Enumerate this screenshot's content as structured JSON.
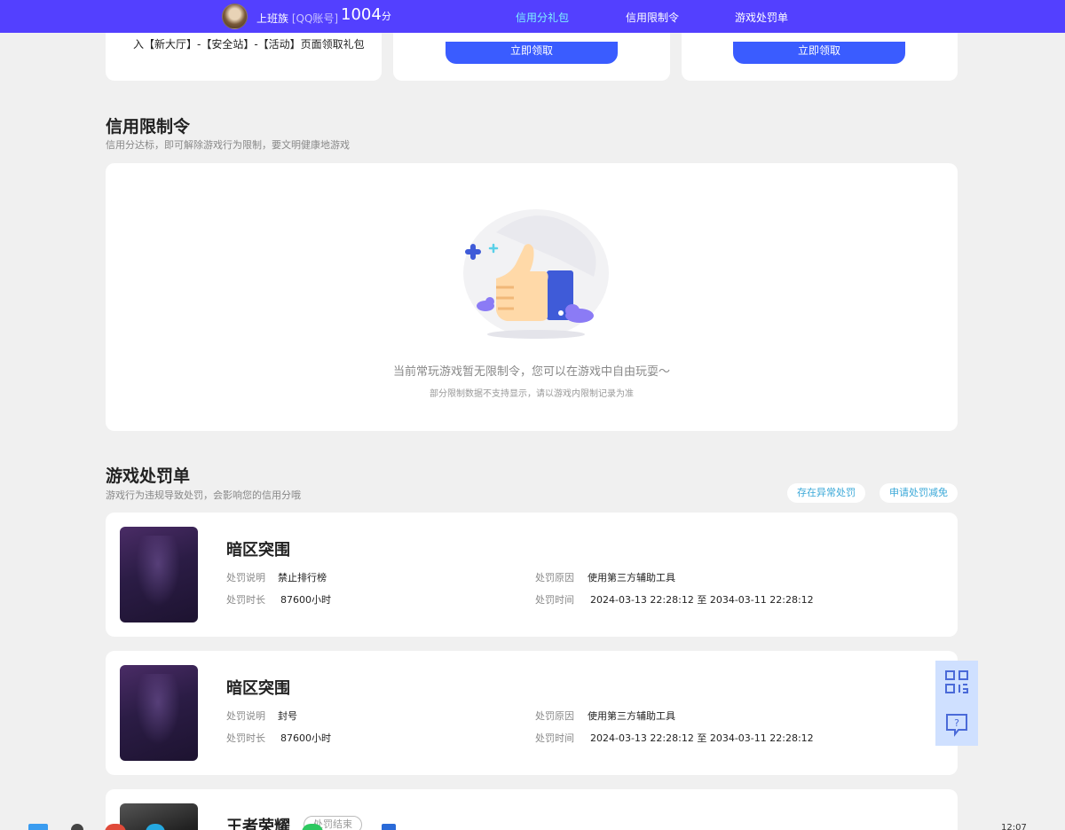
{
  "topbar": {
    "user_name": "上班族",
    "account_tag": "[QQ账号]",
    "score_value": "1004",
    "score_unit": "分",
    "nav": [
      {
        "label": "信用分礼包",
        "active": true
      },
      {
        "label": "信用限制令",
        "active": false
      },
      {
        "label": "游戏处罚单",
        "active": false
      }
    ]
  },
  "gift_cards": {
    "first_text": "入【新大厅】-【安全站】-【活动】页面领取礼包",
    "claim_label": "立即领取"
  },
  "restriction": {
    "title": "信用限制令",
    "subtitle": "信用分达标，即可解除游戏行为限制，要文明健康地游戏",
    "empty_message": "当前常玩游戏暂无限制令，您可以在游戏中自由玩耍～",
    "empty_note": "部分限制数据不支持显示，请以游戏内限制记录为准"
  },
  "punishment": {
    "title": "游戏处罚单",
    "subtitle": "游戏行为违规导致处罚，会影响您的信用分哦",
    "actions": [
      "存在异常处罚",
      "申请处罚减免"
    ],
    "labels": {
      "desc": "处罚说明",
      "duration": "处罚时长",
      "reason": "处罚原因",
      "time": "处罚时间"
    },
    "items": [
      {
        "game": "暗区突围",
        "desc": "禁止排行榜",
        "duration": "87600小时",
        "reason": "使用第三方辅助工具",
        "time": "2024-03-13 22:28:12 至 2034-03-11 22:28:12"
      },
      {
        "game": "暗区突围",
        "desc": "封号",
        "duration": "87600小时",
        "reason": "使用第三方辅助工具",
        "time": "2024-03-13 22:28:12 至 2034-03-11 22:28:12"
      }
    ],
    "partial_item": {
      "game": "王者荣耀",
      "status": "处罚结束"
    }
  },
  "floating": {
    "icons": [
      "qrcode-icon",
      "help-chat-icon"
    ]
  },
  "taskbar": {
    "clock": "12:07"
  },
  "colors": {
    "topbar": "#5340ff",
    "active_nav": "#7ef3ff",
    "button": "#3a5cff",
    "pill_text": "#3aa8d8"
  }
}
